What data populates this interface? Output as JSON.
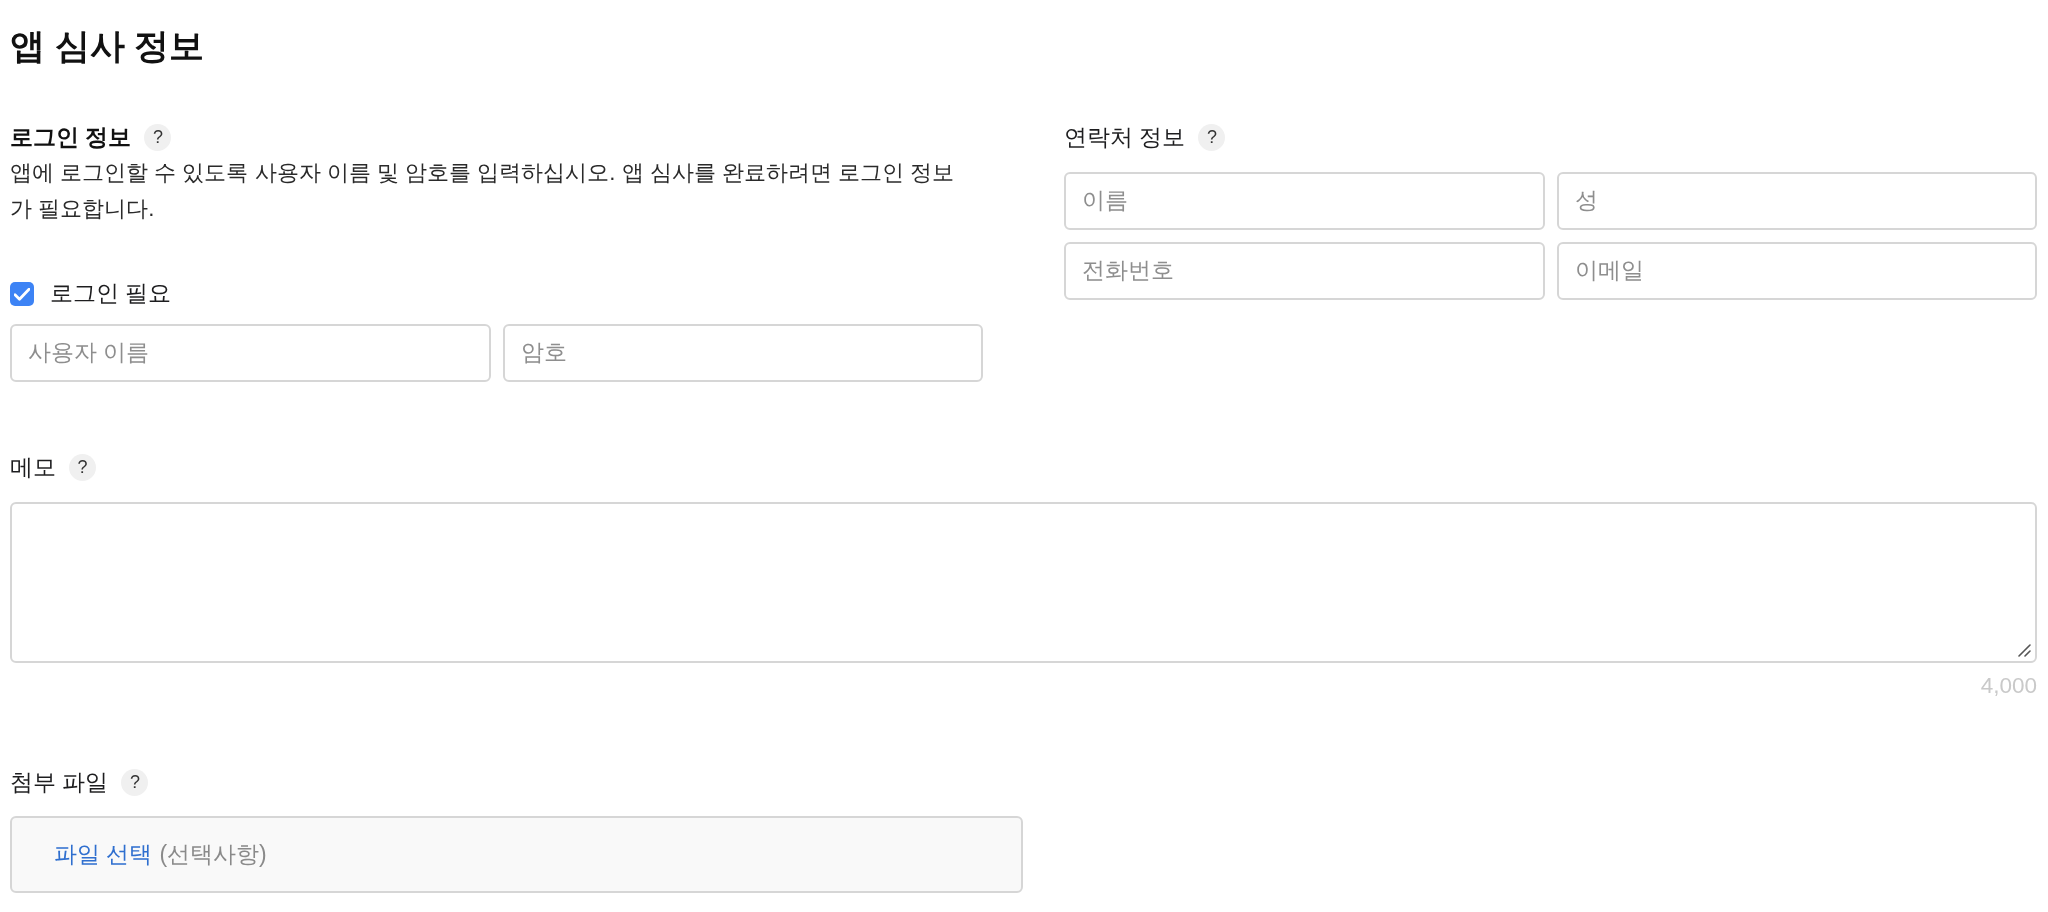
{
  "title": "앱 심사 정보",
  "login_info": {
    "heading": "로그인 정보",
    "help": "?",
    "description": "앱에 로그인할 수 있도록 사용자 이름 및 암호를 입력하십시오. 앱 심사를 완료하려면 로그인 정보가 필요합니다.",
    "login_required": {
      "label": "로그인 필요",
      "checked": true
    },
    "fields": [
      {
        "placeholder": "사용자 이름"
      },
      {
        "placeholder": "암호"
      }
    ]
  },
  "contact_info": {
    "heading": "연락처 정보",
    "help": "?",
    "fields": [
      {
        "placeholder": "이름"
      },
      {
        "placeholder": "성"
      },
      {
        "placeholder": "전화번호"
      },
      {
        "placeholder": "이메일"
      }
    ]
  },
  "notes": {
    "heading": "메모",
    "help": "?",
    "character_limit": "4,000"
  },
  "attachment": {
    "heading": "첨부 파일",
    "help": "?",
    "link": "파일 선택",
    "hint": "(선택사항)"
  }
}
